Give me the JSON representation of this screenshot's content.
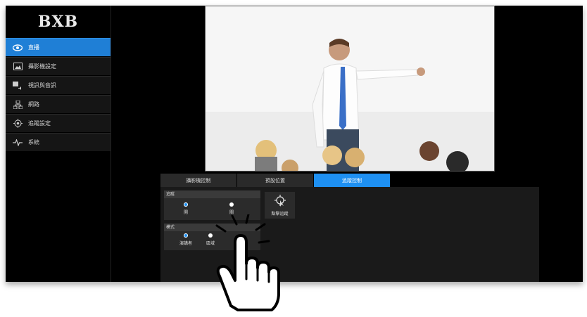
{
  "app": {
    "logo": "BXB"
  },
  "sidebar": {
    "items": [
      {
        "label": "直播",
        "icon": "eye-icon",
        "active": true
      },
      {
        "label": "攝影機設定",
        "icon": "image-icon",
        "active": false
      },
      {
        "label": "視訊與音訊",
        "icon": "video-audio-icon",
        "active": false
      },
      {
        "label": "網路",
        "icon": "network-icon",
        "active": false
      },
      {
        "label": "追蹤設定",
        "icon": "tracking-target-icon",
        "active": false
      },
      {
        "label": "系統",
        "icon": "pulse-icon",
        "active": false
      }
    ]
  },
  "tabs": [
    {
      "label": "攝影機控制",
      "active": false
    },
    {
      "label": "預設位置",
      "active": false
    },
    {
      "label": "追蹤控制",
      "active": true
    }
  ],
  "tracking_panel": {
    "tracking_group": {
      "title": "追蹤",
      "options": [
        {
          "label": "開",
          "selected": true
        },
        {
          "label": "關",
          "selected": false
        }
      ]
    },
    "mode_group": {
      "title": "模式",
      "options": [
        {
          "label": "演講者",
          "selected": true
        },
        {
          "label": "區域",
          "selected": false
        }
      ]
    },
    "click_track_button": {
      "label": "點擊追蹤",
      "icon": "click-target-icon"
    }
  },
  "colors": {
    "accent": "#1e90f2",
    "sidebar_active": "#1f7fd6"
  }
}
